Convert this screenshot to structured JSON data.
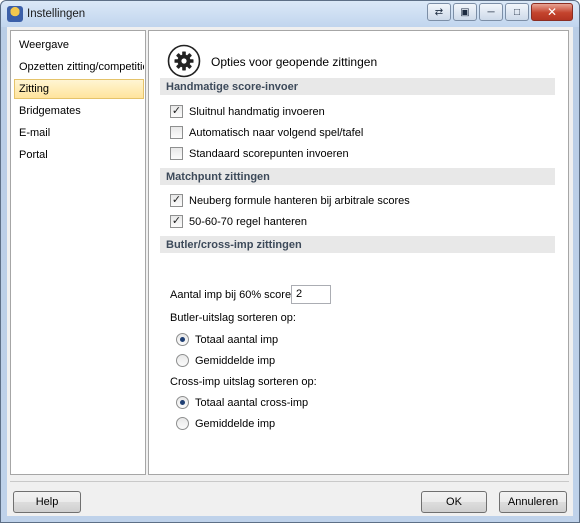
{
  "window": {
    "title": "Instellingen",
    "icon": "app-icon"
  },
  "titlebar_buttons": [
    "back-icon",
    "doc-icon",
    "minimize-icon",
    "maximize-icon",
    "close-icon"
  ],
  "sidebar": {
    "items": [
      {
        "label": "Weergave",
        "selected": false
      },
      {
        "label": "Opzetten zitting/competitie",
        "selected": false
      },
      {
        "label": "Zitting",
        "selected": true
      },
      {
        "label": "Bridgemates",
        "selected": false
      },
      {
        "label": "E-mail",
        "selected": false
      },
      {
        "label": "Portal",
        "selected": false
      }
    ]
  },
  "panel": {
    "title": "Opties voor geopende zittingen",
    "sections": {
      "manual": {
        "header": "Handmatige score-invoer",
        "options": [
          {
            "label": "Sluitnul handmatig invoeren",
            "checked": true
          },
          {
            "label": "Automatisch naar volgend spel/tafel",
            "checked": false
          },
          {
            "label": "Standaard scorepunten invoeren",
            "checked": false
          }
        ]
      },
      "matchpoint": {
        "header": "Matchpunt zittingen",
        "options": [
          {
            "label": "Neuberg formule hanteren bij arbitrale scores",
            "checked": true
          },
          {
            "label": "50-60-70 regel hanteren",
            "checked": true
          }
        ]
      },
      "butler": {
        "header": "Butler/cross-imp zittingen",
        "imp_label": "Aantal imp bij 60% score:",
        "imp_value": "2",
        "butler_sort_label": "Butler-uitslag sorteren op:",
        "butler_sort_options": [
          {
            "label": "Totaal aantal imp",
            "selected": true
          },
          {
            "label": "Gemiddelde imp",
            "selected": false
          }
        ],
        "cross_sort_label": "Cross-imp uitslag sorteren op:",
        "cross_sort_options": [
          {
            "label": "Totaal aantal cross-imp",
            "selected": true
          },
          {
            "label": "Gemiddelde imp",
            "selected": false
          }
        ]
      }
    }
  },
  "footer": {
    "help": "Help",
    "ok": "OK",
    "cancel": "Annuleren"
  }
}
